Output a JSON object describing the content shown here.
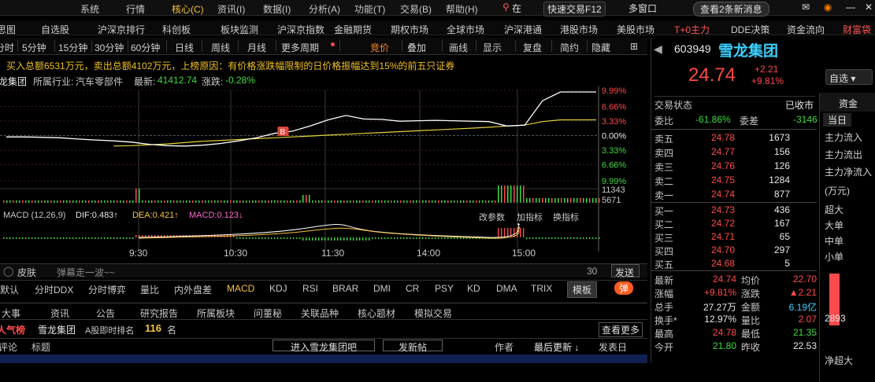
{
  "menu": {
    "items": [
      "系统",
      "行情",
      "核心(C)",
      "资讯(I)",
      "数据(I)",
      "分析(A)",
      "功能(T)",
      "交易(B)",
      "帮助(H)"
    ],
    "location": "在",
    "quick_trade": "快速交易F12",
    "multi_window": "多窗口",
    "news": "查看2条新消息"
  },
  "nav": {
    "items": [
      "自选股",
      "沪深京排行",
      "科创板",
      "板块监测",
      "沪深京指数",
      "金融期货",
      "期权市场",
      "全球市场",
      "沪深港通",
      "港股市场",
      "美股市场",
      "T+0主力",
      "DDE决策",
      "资金流向",
      "财富袋"
    ],
    "left_cut": "思图"
  },
  "period": {
    "items": [
      "分时",
      "5分钟",
      "15分钟",
      "30分钟",
      "60分钟",
      "日线",
      "周线",
      "月线",
      "更多周期",
      "竞价",
      "叠加",
      "画线",
      "显示",
      "复盘",
      "简约",
      "隐藏"
    ]
  },
  "info": {
    "text": "买入总额6531万元，卖出总额4102万元，上榜原因：有价格涨跌幅限制的日价格振幅达到15%的前五只证券"
  },
  "title": {
    "name": "龙集团",
    "industry_label": "所属行业:",
    "industry": "汽车零部件",
    "latest_label": "最新:",
    "latest": "41412.74",
    "change_label": "涨跌:",
    "change": "-0.28%"
  },
  "chart_data": {
    "type": "line",
    "title": "",
    "pct_axis": [
      "9.99%",
      "6.66%",
      "3.33%",
      "0.00%",
      "3.33%",
      "6.66%",
      "9.99%"
    ],
    "vol_axis": [
      "11343",
      "5671"
    ],
    "x_ticks": [
      "9:30",
      "10:30",
      "11:30",
      "14:00",
      "15:00"
    ],
    "price_series": [
      -0.3,
      -0.3,
      -0.4,
      -0.5,
      -0.8,
      -1.0,
      -1.2,
      -1.5,
      -2.0,
      -2.3,
      -2.4,
      -2.2,
      -1.8,
      -1.2,
      -0.5,
      0.5,
      1.0,
      2.2,
      3.6,
      4.6,
      3.8,
      3.7,
      3.3,
      3.4,
      3.5,
      3.4,
      3.3,
      3.2,
      2.2,
      2.4,
      8.0,
      9.99,
      9.99,
      9.99
    ],
    "avg_series": [
      0,
      0,
      0,
      0,
      0,
      0,
      -2.4,
      -2.3,
      -2.1,
      -1.9,
      -1.6,
      -1.3,
      -1.1,
      -0.9,
      -0.7,
      -0.5,
      -0.3,
      -0.1,
      0.1,
      0.3,
      0.5,
      0.7,
      0.9,
      1.1,
      1.3,
      1.5,
      1.7,
      1.9,
      2.2,
      2.4,
      3.2,
      3.6,
      3.6,
      3.6
    ],
    "badge": "B",
    "macd": {
      "label": "MACD (12,26,9)",
      "dif": "DIF:0.483↑",
      "dea": "DEA:0.421↑",
      "macd": "MACD:0.123↓",
      "params": "改参数",
      "add": "加指标",
      "switch": "换指标"
    }
  },
  "chat": {
    "skin": "皮肤",
    "placeholder": "弹幕走一波~~",
    "count": "30",
    "send": "发送"
  },
  "indicators": {
    "items": [
      "默认",
      "分时DDX",
      "分时博弈",
      "量比",
      "内外盘差",
      "MACD",
      "KDJ",
      "RSI",
      "BRAR",
      "DMI",
      "CR",
      "PSY",
      "KD",
      "DMA",
      "TRIX"
    ],
    "template": "模板",
    "danmu": "弹"
  },
  "bottom_tabs": {
    "items": [
      "大事",
      "资讯",
      "公告",
      "研究报告",
      "所属板块",
      "问董秘",
      "关联品种",
      "核心题材",
      "模拟交易"
    ]
  },
  "popularity": {
    "title": "人气榜",
    "stock": "雪龙集团",
    "rank_label": "A股即时排名",
    "rank": "116",
    "rank_unit": "名",
    "more": "查看更多"
  },
  "list_head": {
    "c1": "评论",
    "c2": "标题",
    "btn1": "进入雪龙集团吧",
    "btn2": "发新帖",
    "author": "作者",
    "latest": "最后更新 ↓",
    "post_time": "发表日"
  },
  "quote": {
    "code": "603949",
    "name": "雪龙集团",
    "price": "24.74",
    "chg": "+2.21",
    "pct": "+9.81%",
    "watch": "自选",
    "status_label": "交易状态",
    "status": "已收市",
    "wb_label": "委比",
    "wb": "-61.86%",
    "wc_label": "委差",
    "wc": "-3146",
    "asks": [
      {
        "l": "卖五",
        "p": "24.78",
        "v": "1673"
      },
      {
        "l": "卖四",
        "p": "24.77",
        "v": "156"
      },
      {
        "l": "卖三",
        "p": "24.76",
        "v": "126"
      },
      {
        "l": "卖二",
        "p": "24.75",
        "v": "1284"
      },
      {
        "l": "卖一",
        "p": "24.74",
        "v": "877"
      }
    ],
    "bids": [
      {
        "l": "买一",
        "p": "24.73",
        "v": "436"
      },
      {
        "l": "买二",
        "p": "24.72",
        "v": "167"
      },
      {
        "l": "买三",
        "p": "24.71",
        "v": "65"
      },
      {
        "l": "买四",
        "p": "24.70",
        "v": "297"
      },
      {
        "l": "买五",
        "p": "24.68",
        "v": "5"
      }
    ],
    "stats": [
      {
        "a": "最新",
        "av": "24.74",
        "b": "均价",
        "bv": "22.70"
      },
      {
        "a": "涨幅",
        "av": "+9.81%",
        "b": "涨跌",
        "bv": "▲2.21"
      },
      {
        "a": "总手",
        "av": "27.27万",
        "b": "金额",
        "bv": "6.19亿"
      },
      {
        "a": "换手*",
        "av": "12.97%",
        "b": "量比",
        "bv": "2.07"
      },
      {
        "a": "最高",
        "av": "24.78",
        "b": "最低",
        "bv": "21.35"
      },
      {
        "a": "今开",
        "av": "21.80",
        "b": "昨收",
        "bv": "22.53"
      }
    ]
  },
  "side": {
    "tab1": "资金",
    "tab2": "当日",
    "items": [
      "主力流入",
      "主力流出",
      "主力净流入",
      "(万元)",
      "超大",
      "大单",
      "中单",
      "小单"
    ],
    "bar_value": "2893",
    "bottom": "净超大"
  }
}
